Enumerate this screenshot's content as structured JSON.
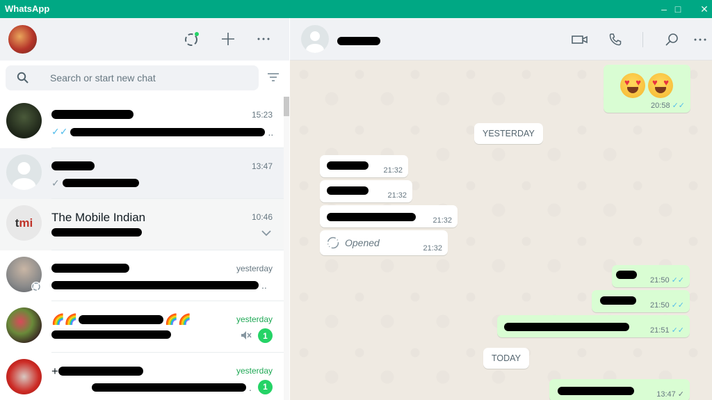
{
  "window": {
    "title": "WhatsApp",
    "controls": {
      "minimize": "–",
      "maximize": "□",
      "close": "✕"
    }
  },
  "sidebar": {
    "header_icons": [
      "status-icon",
      "new-chat-icon",
      "menu-icon"
    ],
    "search": {
      "placeholder": "Search or start new chat",
      "value": ""
    },
    "chats": [
      {
        "name": "[redacted]",
        "time": "15:23",
        "receipt": "read",
        "preview": "[redacted]",
        "unread": null,
        "active": false
      },
      {
        "name": "[redacted]",
        "time": "13:47",
        "receipt": "sent",
        "preview": "[redacted]",
        "unread": null,
        "active": true
      },
      {
        "name": "The Mobile Indian",
        "time": "10:46",
        "receipt": null,
        "preview": "[redacted]",
        "unread": null,
        "active": false,
        "hover_chevron": true
      },
      {
        "name": "[redacted]",
        "time": "yesterday",
        "receipt": null,
        "preview": "[redacted]",
        "unread": null,
        "active": false
      },
      {
        "name": "🌈🌈 [redacted] 🌈🌈",
        "time": "yesterday",
        "receipt": null,
        "preview": "[redacted]",
        "unread": "1",
        "muted": true,
        "active": false
      },
      {
        "name": "+[redacted]",
        "time": "yesterday",
        "receipt": null,
        "preview": "[redacted]",
        "unread": "1",
        "active": false
      }
    ]
  },
  "conversation": {
    "contact_name": "[redacted]",
    "header_icons": [
      "video-call-icon",
      "voice-call-icon",
      "search-icon",
      "menu-icon"
    ],
    "messages": [
      {
        "dir": "out",
        "text": "😍😍",
        "time": "20:58",
        "receipt": "read"
      },
      {
        "type": "date",
        "label": "YESTERDAY"
      },
      {
        "dir": "in",
        "text": "[redacted]",
        "time": "21:32"
      },
      {
        "dir": "in",
        "text": "[redacted]",
        "time": "21:32"
      },
      {
        "dir": "in",
        "text": "[redacted]",
        "time": "21:32"
      },
      {
        "dir": "in",
        "text": "Opened",
        "time": "21:32",
        "view_once": true
      },
      {
        "dir": "out",
        "text": "[redacted]",
        "time": "21:50",
        "receipt": "read"
      },
      {
        "dir": "out",
        "text": "[redacted]",
        "time": "21:50",
        "receipt": "read"
      },
      {
        "dir": "out",
        "text": "[redacted]",
        "time": "21:51",
        "receipt": "read"
      },
      {
        "type": "date",
        "label": "TODAY"
      },
      {
        "dir": "out",
        "text": "[redacted]",
        "time": "13:47",
        "receipt": "sent"
      }
    ]
  },
  "colors": {
    "brand": "#00a884",
    "unread": "#25d366",
    "read_tick": "#53bdeb",
    "outgoing_bubble": "#d9fdd3"
  }
}
